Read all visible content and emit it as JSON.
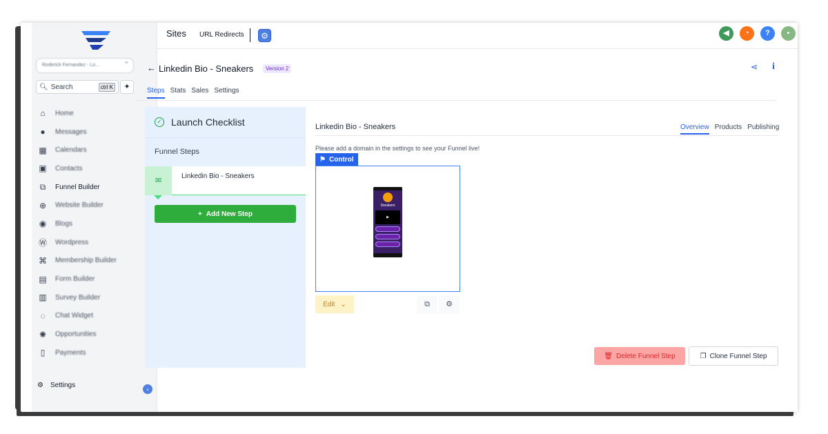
{
  "sidebar": {
    "location_selector": "Roderick Fernandez - Lo...",
    "search": {
      "placeholder": "Search",
      "shortcut": "ctrl K"
    },
    "items": [
      {
        "label": "Home",
        "icon": "home-icon"
      },
      {
        "label": "Messages",
        "icon": "chat-bubble-icon"
      },
      {
        "label": "Calendars",
        "icon": "calendar-icon"
      },
      {
        "label": "Contacts",
        "icon": "contact-card-icon"
      },
      {
        "label": "Funnel Builder",
        "icon": "funnel-builder-icon"
      },
      {
        "label": "Website Builder",
        "icon": "globe-icon"
      },
      {
        "label": "Blogs",
        "icon": "blog-icon"
      },
      {
        "label": "Wordpress",
        "icon": "wordpress-icon"
      },
      {
        "label": "Membership Builder",
        "icon": "membership-icon"
      },
      {
        "label": "Form Builder",
        "icon": "form-icon"
      },
      {
        "label": "Survey Builder",
        "icon": "survey-icon"
      },
      {
        "label": "Chat Widget",
        "icon": "chat-widget-icon"
      },
      {
        "label": "Opportunities",
        "icon": "opportunities-icon"
      },
      {
        "label": "Payments",
        "icon": "payments-icon"
      }
    ],
    "settings_label": "Settings"
  },
  "topbar": {
    "title": "Sites",
    "link": "URL Redirects"
  },
  "header": {
    "back_arrow": "←",
    "title": "Linkedin Bio - Sneakers",
    "version": "Version 2",
    "tabs": [
      "Steps",
      "Stats",
      "Sales",
      "Settings"
    ]
  },
  "steps_panel": {
    "launch_checklist": "Launch Checklist",
    "funnel_steps": "Funnel Steps",
    "step_name": "Linkedin Bio - Sneakers",
    "add_step": "Add New Step"
  },
  "content": {
    "title": "Linkedin Bio - Sneakers",
    "tabs": [
      "Overview",
      "Products",
      "Publishing"
    ],
    "note": "Please add a domain in the settings to see your Funnel live!",
    "control_label": "Control",
    "preview_heading": "Sneakers",
    "edit_label": "Edit",
    "delete_label": "Delete Funnel Step",
    "clone_label": "Clone Funnel Step"
  },
  "colors": {
    "accent": "#2563eb",
    "add_button": "#2fad3c",
    "delete_button_bg": "#fca5a5",
    "steps_panel_bg": "#e7f1fd"
  }
}
